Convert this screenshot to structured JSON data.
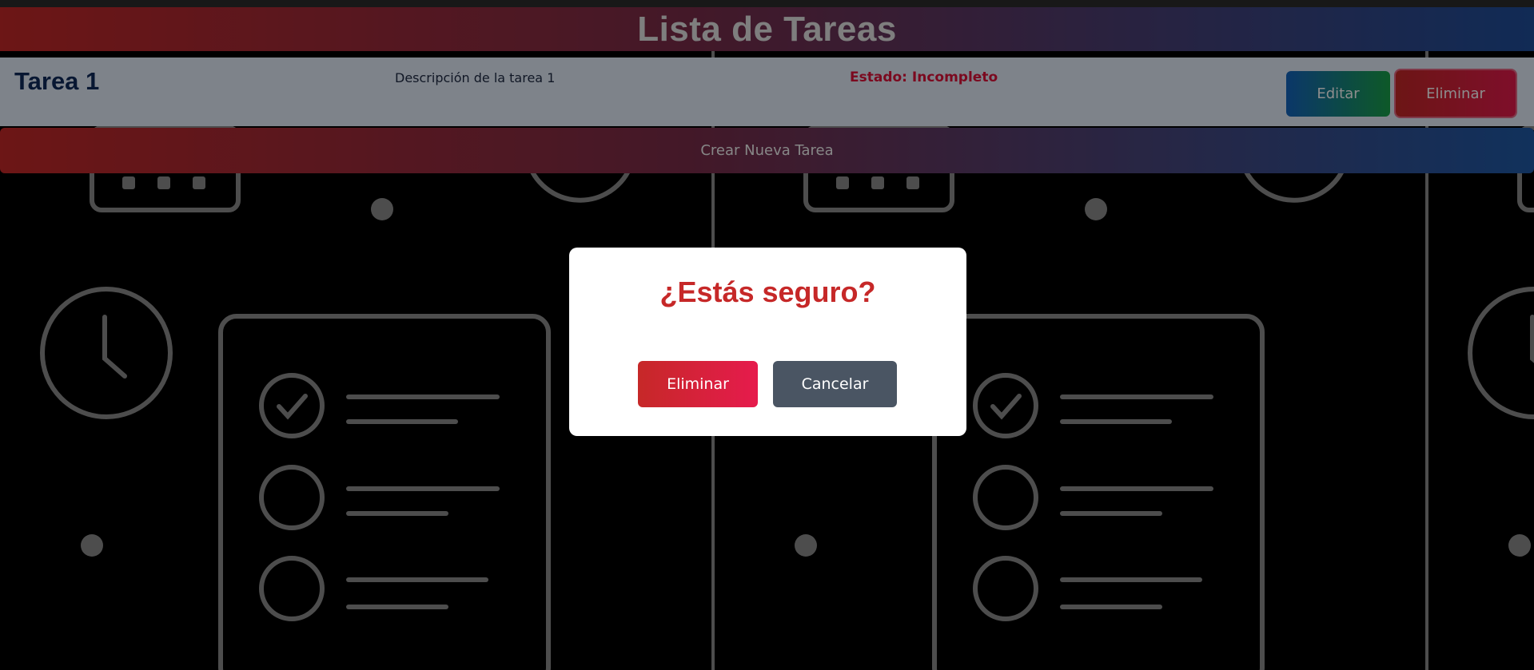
{
  "app": {
    "title": "Lista de Tareas"
  },
  "task": {
    "title": "Tarea 1",
    "description": "Descripción de la tarea 1",
    "status": "Estado: Incompleto",
    "edit_label": "Editar",
    "delete_label": "Eliminar"
  },
  "create_label": "Crear Nueva Tarea",
  "modal": {
    "title": "¿Estás seguro?",
    "confirm_label": "Eliminar",
    "cancel_label": "Cancelar"
  },
  "background": {
    "icons": [
      "calendar-icon",
      "clock-icon",
      "checklist-icon",
      "checkmark-icon"
    ]
  },
  "colors": {
    "accent_red": "#c62828",
    "accent_blue": "#1f4f9c",
    "status_red": "#e0123a",
    "cancel_gray": "#4a5563"
  }
}
